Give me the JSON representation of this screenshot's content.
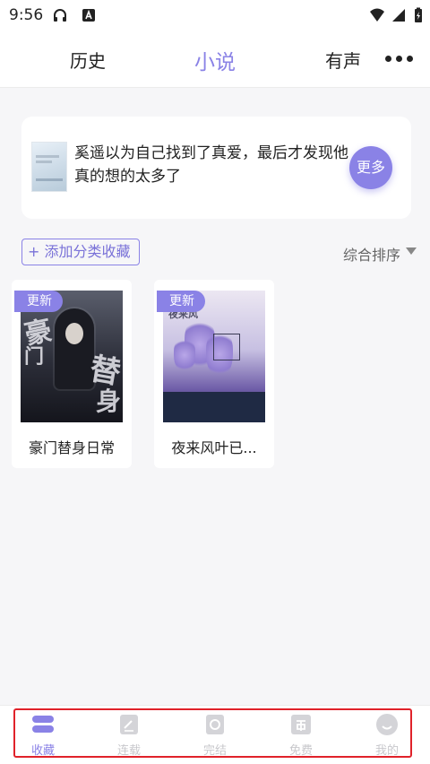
{
  "status_bar": {
    "time": "9:56",
    "icons": [
      "headphones-icon",
      "notification-a-icon",
      "wifi-icon",
      "signal-icon",
      "battery-icon"
    ]
  },
  "header": {
    "tabs": [
      {
        "label": "历史",
        "active": false
      },
      {
        "label": "小说",
        "active": true
      },
      {
        "label": "有声",
        "active": false
      }
    ],
    "more_icon": "more-dots-icon"
  },
  "banner": {
    "text": "奚遥以为自己找到了真爱，最后才发现他真的想的太多了",
    "more_label": "更多"
  },
  "toolbar": {
    "add_category_label": "+ 添加分类收藏",
    "sort_label": "综合排序"
  },
  "books": [
    {
      "title": "豪门替身日常",
      "badge": "更新"
    },
    {
      "title": "夜来风叶已...",
      "badge": "更新"
    }
  ],
  "bottom_nav": {
    "items": [
      {
        "label": "收藏",
        "icon": "bookshelf-icon",
        "active": true
      },
      {
        "label": "连载",
        "icon": "serial-icon",
        "active": false
      },
      {
        "label": "完结",
        "icon": "completed-icon",
        "active": false
      },
      {
        "label": "免费",
        "icon": "free-icon",
        "active": false
      },
      {
        "label": "我的",
        "icon": "profile-icon",
        "active": false
      }
    ]
  },
  "colors": {
    "accent": "#8a82e6",
    "highlight_border": "#e0222a",
    "background": "#f6f6f8",
    "inactive": "#c8c8cc"
  }
}
